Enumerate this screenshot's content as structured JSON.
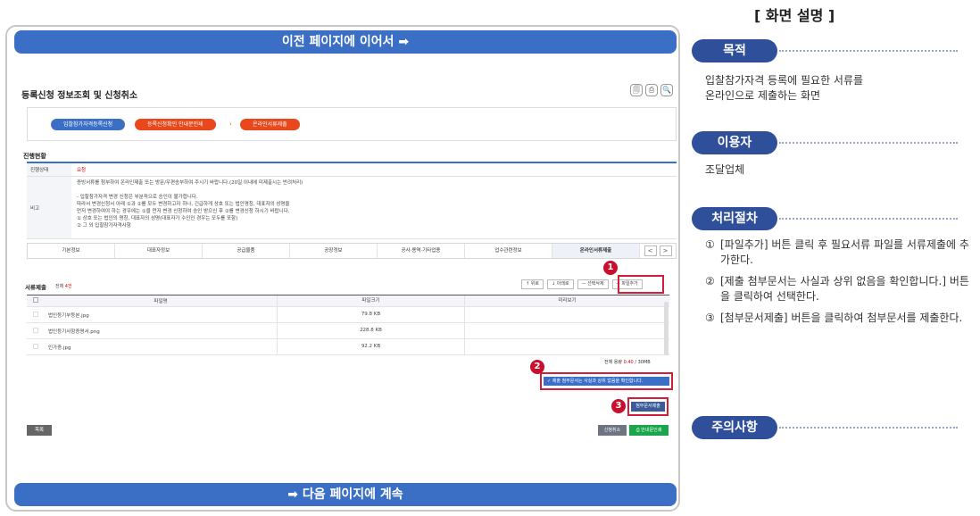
{
  "banner": {
    "top": "이전 페이지에 이어서 ➡",
    "bottom": "➡ 다음 페이지에 계속"
  },
  "app": {
    "title": "등록신청 정보조회 및 신청취소",
    "title_icons": [
      "🗐",
      "⎙",
      "🔍"
    ],
    "steps": [
      "입찰참가자격등록신청",
      "등록신청확인 안내문인쇄",
      "온라인서류제출"
    ],
    "section_label": "진행현황",
    "status": {
      "state_label": "진행상태",
      "state_value": "요청",
      "note_label": "비고",
      "notes": [
        "증빙서류를 첨부하여 온라인제출 또는 방문/우편송부하여 주시기 바랍니다.(20일 이내에 미제출시는 반려처리)",
        "",
        "- 입찰참가자격 변경 신청은 부분적으로 승인이 불가합니다.",
        "  따라서 변경신청서 아래 ①과 ②를 모두 변경하고자 하나, 긴급하게 상호 또는 법인명칭, 대표자의 성명을",
        "  먼저 변경하여야 하는 경우에는 ①을 먼저 변경 신청하여 승인 받으신 후 ②를 변경신청 하시기 바랍니다.",
        "  ① 상호 또는 법인의 명칭, 대표자의 성명(대표자가 수인인 경우는 모두를 포함)",
        "  ② 그 외 입찰참가자격사항"
      ]
    },
    "tabs": [
      "기본정보",
      "대표자정보",
      "공급물품",
      "공장정보",
      "공사·용역·기타업종",
      "업수관련정보",
      "온라인서류제출"
    ],
    "tab_nav": [
      "<",
      ">"
    ],
    "docs": {
      "title": "서류제출",
      "count_label": "전체",
      "count_value": "4건",
      "toolbar": [
        "↑ 위로",
        "↓ 아래로",
        "— 선택삭제",
        "+ 파일추가"
      ],
      "columns": [
        "파일명",
        "파일크기",
        "미리보기"
      ],
      "rows": [
        {
          "name": "법인등기부등본.jpg",
          "size": "79.8 KB"
        },
        {
          "name": "법인등기사항증명서.png",
          "size": "228.8 KB"
        },
        {
          "name": "인가증.jpg",
          "size": "92.2 KB"
        }
      ],
      "capacity_label": "전체 용량",
      "capacity_used": "0.40",
      "capacity_total": " / 30MB"
    },
    "confirm_label": "✓ 제출 첨부문서는 사실과 상위 없음을 확인합니다.",
    "submit_label": "첨부문서제출",
    "list_label": "목록",
    "cancel_label": "신청취소",
    "guide_label": "⎙ 안내문인쇄",
    "badges": [
      "1",
      "2",
      "3"
    ]
  },
  "panel": {
    "title": "[ 화면 설명 ]",
    "purpose_label": "목적",
    "purpose_text": [
      "입찰참가자격 등록에 필요한 서류를",
      "온라인으로 제출하는 화면"
    ],
    "user_label": "이용자",
    "user_text": "조달업체",
    "procedure_label": "처리절차",
    "procedure_steps": [
      {
        "num": "①",
        "text": "[파일추가] 버튼 클릭 후 필요서류 파일를 서류제출에 추가한다."
      },
      {
        "num": "②",
        "text": "[제출 첨부문서는 사실과 상위 없음을 확인합니다.] 버튼을 클릭하여 선택한다."
      },
      {
        "num": "③",
        "text": "[첨부문서제출] 버튼을 클릭하여 첨부문서를 제출한다."
      }
    ],
    "caution_label": "주의사항"
  },
  "colors": {
    "banner": "#3b6fc6",
    "pill": "#2f4f9a",
    "highlight": "#d01e3c",
    "step_orange": "#e8481c",
    "green": "#1aa64a"
  }
}
